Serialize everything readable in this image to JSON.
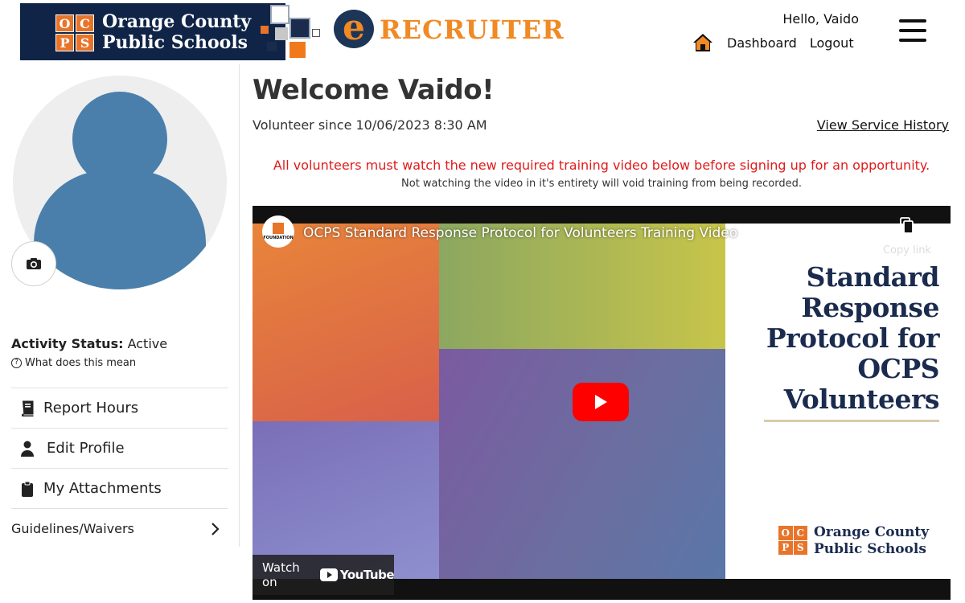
{
  "header": {
    "logo_text": [
      "Orange County",
      "Public Schools"
    ],
    "logo_blocks": [
      "O",
      "C",
      "P",
      "S"
    ],
    "brand_name": "RECRUITER",
    "brand_e": "e",
    "greeting": "Hello, Vaido",
    "dashboard_label": "Dashboard",
    "logout_label": "Logout"
  },
  "sidebar": {
    "status_label": "Activity Status:",
    "status_value": "Active",
    "help_label": "What does this mean",
    "items": [
      {
        "label": "Report Hours",
        "icon": "book-icon"
      },
      {
        "label": "Edit Profile",
        "icon": "person-icon"
      },
      {
        "label": "My Attachments",
        "icon": "clipboard-icon"
      },
      {
        "label": "Guidelines/Waivers",
        "icon": "chevron-right-icon"
      }
    ]
  },
  "main": {
    "welcome": "Welcome Vaido!",
    "since": "Volunteer since 10/06/2023 8:30 AM",
    "history_link": "View Service History",
    "alert": "All volunteers must watch the new required training video below before signing up for an opportunity.",
    "alert_sub": "Not watching the video in it's entirety will void training from being recorded."
  },
  "video": {
    "title": "OCPS Standard Response Protocol for Volunteers Training Video",
    "copy_link": "Copy link",
    "channel_caption": "FOUNDATION",
    "slide_title_lines": [
      "Standard",
      "Response",
      "Protocol for",
      "OCPS",
      "Volunteers"
    ],
    "slide_logo_lines": [
      "Orange County",
      "Public Schools"
    ],
    "watch_on": "Watch on",
    "youtube": "YouTube"
  },
  "colors": {
    "brand_orange": "#f08a24",
    "navy": "#0f2447",
    "alert_red": "#e01b1b",
    "avatar_blue": "#4a7fab",
    "play_red": "#ff0000"
  }
}
